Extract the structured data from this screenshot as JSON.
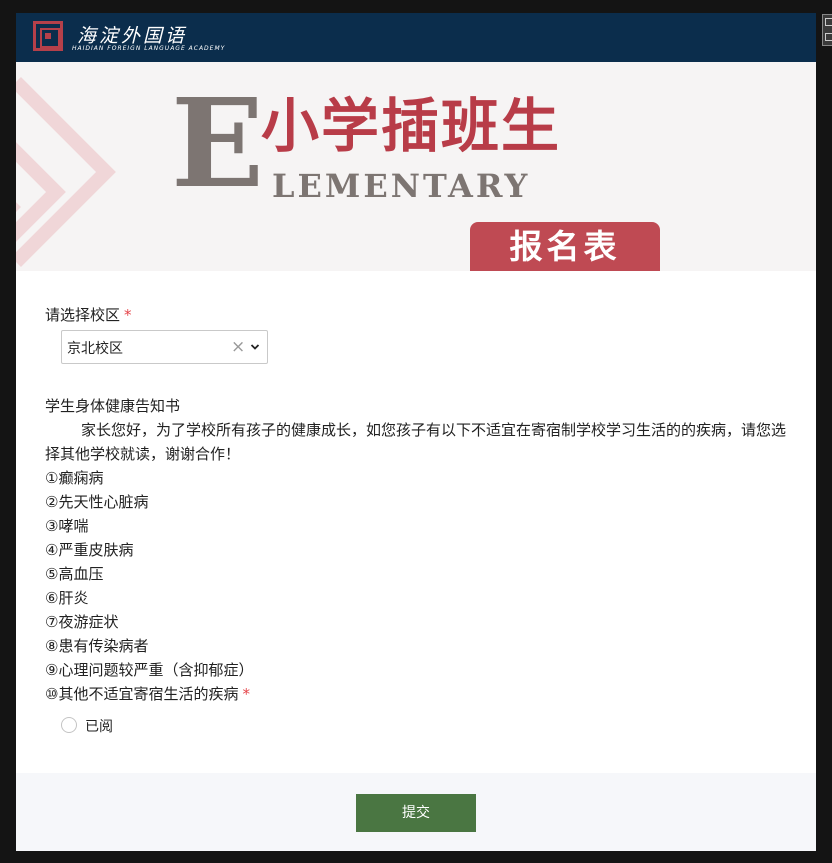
{
  "header": {
    "logo_cn": "海淀外国语",
    "logo_en": "HAIDIAN FOREIGN LANGUAGE ACADEMY"
  },
  "banner": {
    "big_letter": "E",
    "title_cn": "小学插班生",
    "title_en": "LEMENTARY",
    "badge": "报名表"
  },
  "form": {
    "campus": {
      "label": "请选择校区",
      "required_mark": "*",
      "selected": "京北校区",
      "clear_icon": "×",
      "dropdown_icon": "chevron-down"
    },
    "notice": {
      "title": "学生身体健康告知书",
      "body": "家长您好，为了学校所有孩子的健康成长，如您孩子有以下不适宜在寄宿制学校学习生活的的疾病，请您选择其他学校就读，谢谢合作！",
      "items": [
        "①癫痫病",
        "②先天性心脏病",
        "③哮喘",
        "④严重皮肤病",
        "⑤高血压",
        "⑥肝炎",
        "⑦夜游症状",
        "⑧患有传染病者",
        "⑨心理问题较严重（含抑郁症）"
      ],
      "last_item": "⑩其他不适宜寄宿生活的疾病",
      "required_mark": "*"
    },
    "acknowledge_option": "已阅"
  },
  "footer": {
    "submit_label": "提交"
  }
}
